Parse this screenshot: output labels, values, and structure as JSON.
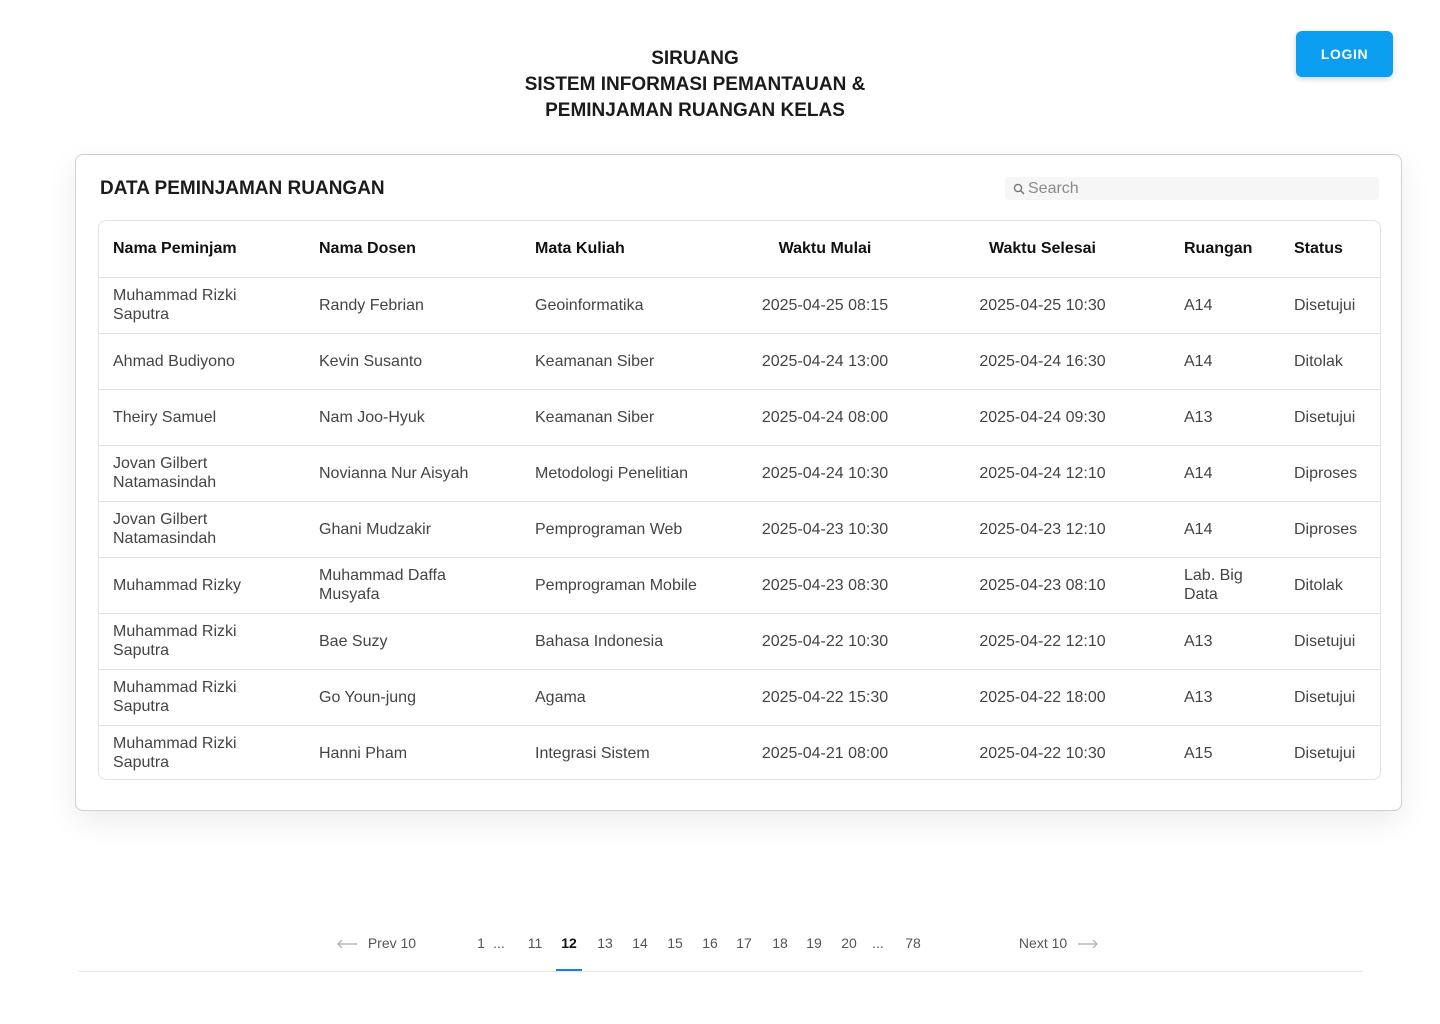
{
  "header": {
    "line1": "SIRUANG",
    "line2": "SISTEM INFORMASI PEMANTAUAN &",
    "line3": "PEMINJAMAN RUANGAN KELAS",
    "login_label": "LOGIN",
    "accent_color": "#0b9ef0"
  },
  "card": {
    "title": "DATA PEMINJAMAN RUANGAN",
    "search_placeholder": "Search",
    "search_icon": "search-icon"
  },
  "table": {
    "headers": [
      "Nama Peminjam",
      "Nama Dosen",
      "Mata Kuliah",
      "Waktu Mulai",
      "Waktu Selesai",
      "Ruangan",
      "Status"
    ],
    "rows": [
      [
        "Muhammad Rizki Saputra",
        "Randy Febrian",
        "Geoinformatika",
        "2025-04-25 08:15",
        "2025-04-25 10:30",
        "A14",
        "Disetujui"
      ],
      [
        "Ahmad Budiyono",
        "Kevin Susanto",
        "Keamanan Siber",
        "2025-04-24 13:00",
        "2025-04-24 16:30",
        "A14",
        "Ditolak"
      ],
      [
        "Theiry Samuel",
        "Nam Joo-Hyuk",
        "Keamanan Siber",
        "2025-04-24 08:00",
        "2025-04-24 09:30",
        "A13",
        "Disetujui"
      ],
      [
        "Jovan Gilbert Natamasindah",
        "Novianna Nur Aisyah",
        "Metodologi Penelitian",
        "2025-04-24 10:30",
        "2025-04-24 12:10",
        "A14",
        "Diproses"
      ],
      [
        "Jovan Gilbert Natamasindah",
        "Ghani Mudzakir",
        "Pemprograman Web",
        "2025-04-23 10:30",
        "2025-04-23 12:10",
        "A14",
        "Diproses"
      ],
      [
        "Muhammad Rizky",
        "Muhammad Daffa Musyafa",
        "Pemprograman Mobile",
        "2025-04-23 08:30",
        "2025-04-23 08:10",
        "Lab. Big Data",
        "Ditolak"
      ],
      [
        "Muhammad Rizki Saputra",
        "Bae Suzy",
        "Bahasa Indonesia",
        "2025-04-22 10:30",
        "2025-04-22 12:10",
        "A13",
        "Disetujui"
      ],
      [
        "Muhammad Rizki Saputra",
        "Go Youn-jung",
        "Agama",
        "2025-04-22 15:30",
        "2025-04-22 18:00",
        "A13",
        "Disetujui"
      ],
      [
        "Muhammad Rizki Saputra",
        "Hanni Pham",
        "Integrasi Sistem",
        "2025-04-21 08:00",
        "2025-04-22 10:30",
        "A15",
        "Disetujui"
      ]
    ]
  },
  "pagination": {
    "prev_label": "Prev 10",
    "next_label": "Next 10",
    "pages": [
      "1",
      "...",
      "11",
      "12",
      "13",
      "14",
      "15",
      "16",
      "17",
      "18",
      "19",
      "20",
      "...",
      "78"
    ],
    "active_page": "12"
  }
}
